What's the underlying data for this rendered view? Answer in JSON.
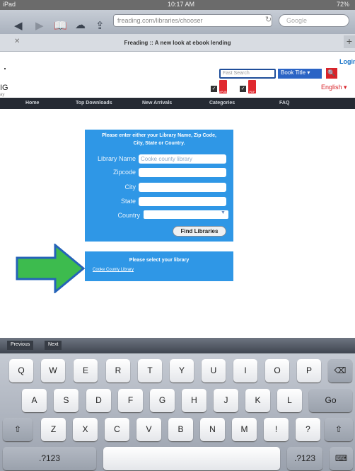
{
  "status_bar": {
    "device": "iPad",
    "time": "10:17 AM",
    "battery": "72%"
  },
  "browser": {
    "url": "freading.com/libraries/chooser",
    "search_placeholder": "Google",
    "tab_title": "Freading :: A new look at ebook lending"
  },
  "header": {
    "login": "Login",
    "logo_fragment": "IG",
    "search_placeholder": "Fast Search",
    "search_type": "Book Title ▾",
    "format_epub": "ePUB",
    "format_pdf": "PDF",
    "language": "English ▾"
  },
  "nav": {
    "items": [
      "Home",
      "Top Downloads",
      "New Arrivals",
      "Categories",
      "FAQ"
    ]
  },
  "chooser": {
    "prompt_line1": "Please enter either your Library Name, Zip Code,",
    "prompt_line2": "City, State or Country.",
    "fields": [
      {
        "label": "Library Name",
        "value": "Cooke county library"
      },
      {
        "label": "Zipcode",
        "value": ""
      },
      {
        "label": "City",
        "value": ""
      },
      {
        "label": "State",
        "value": ""
      }
    ],
    "country_label": "Country",
    "find_button": "Find Libraries"
  },
  "results": {
    "prompt": "Please select your library",
    "library_link": "Cooke County Library"
  },
  "keyboard": {
    "previous": "Previous",
    "next": "Next",
    "row1": [
      "Q",
      "W",
      "E",
      "R",
      "T",
      "Y",
      "U",
      "I",
      "O",
      "P"
    ],
    "row2": [
      "A",
      "S",
      "D",
      "F",
      "G",
      "H",
      "J",
      "K",
      "L"
    ],
    "row3": [
      "Z",
      "X",
      "C",
      "V",
      "B",
      "N",
      "M",
      "!",
      "?"
    ],
    "go": "Go",
    "numbers": ".?123"
  },
  "colors": {
    "panel": "#2f97e6",
    "nav": "#252a33",
    "arrow": "#3dbb4e",
    "arrow_border": "#2563b8"
  }
}
